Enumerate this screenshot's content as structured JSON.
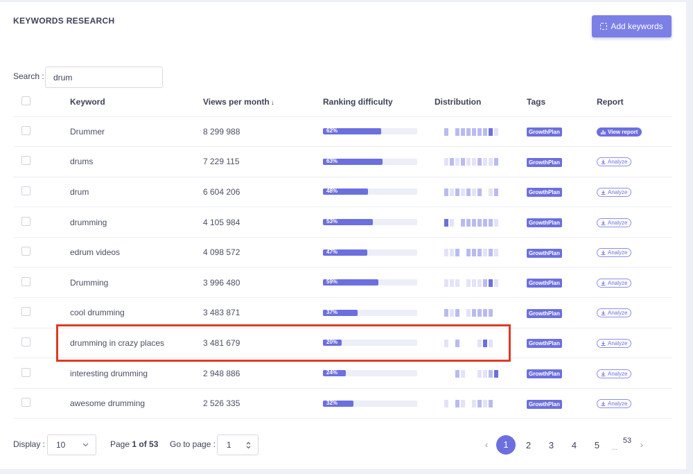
{
  "header": {
    "title": "KEYWORDS RESEARCH",
    "add_button": "Add keywords"
  },
  "search": {
    "label": "Search :",
    "value": "drum"
  },
  "table": {
    "columns": [
      "Keyword",
      "Views per month",
      "Ranking difficulty",
      "Distribution",
      "Tags",
      "Report"
    ],
    "sort_indicator": "↓",
    "rows": [
      {
        "keyword": "Drummer",
        "views": "8 299 988",
        "difficulty": 62,
        "difficulty_label": "62%",
        "tag": "GrowthPlan",
        "report": "View report",
        "report_type": "view",
        "dist": [
          2,
          0,
          2,
          2,
          2,
          2,
          2,
          2,
          3,
          1
        ]
      },
      {
        "keyword": "drums",
        "views": "7 229 115",
        "difficulty": 63,
        "difficulty_label": "63%",
        "tag": "GrowthPlan",
        "report": "Analyze",
        "report_type": "analyze",
        "dist": [
          1,
          2,
          1,
          2,
          1,
          1,
          2,
          1,
          1,
          2
        ]
      },
      {
        "keyword": "drum",
        "views": "6 604 206",
        "difficulty": 48,
        "difficulty_label": "48%",
        "tag": "GrowthPlan",
        "report": "Analyze",
        "report_type": "analyze",
        "dist": [
          2,
          1,
          2,
          1,
          2,
          1,
          2,
          0,
          1,
          2
        ]
      },
      {
        "keyword": "drumming",
        "views": "4 105 984",
        "difficulty": 53,
        "difficulty_label": "53%",
        "tag": "GrowthPlan",
        "report": "Analyze",
        "report_type": "analyze",
        "dist": [
          3,
          1,
          0,
          2,
          2,
          2,
          2,
          2,
          2,
          1
        ]
      },
      {
        "keyword": "edrum videos",
        "views": "4 098 572",
        "difficulty": 47,
        "difficulty_label": "47%",
        "tag": "GrowthPlan",
        "report": "Analyze",
        "report_type": "analyze",
        "dist": [
          1,
          1,
          2,
          0,
          2,
          2,
          2,
          1,
          2,
          1
        ]
      },
      {
        "keyword": "Drumming",
        "views": "3 996 480",
        "difficulty": 59,
        "difficulty_label": "59%",
        "tag": "GrowthPlan",
        "report": "Analyze",
        "report_type": "analyze",
        "dist": [
          1,
          1,
          1,
          0,
          1,
          1,
          1,
          2,
          3,
          1
        ]
      },
      {
        "keyword": "cool drumming",
        "views": "3 483 871",
        "difficulty": 37,
        "difficulty_label": "37%",
        "tag": "GrowthPlan",
        "report": "Analyze",
        "report_type": "analyze",
        "dist": [
          2,
          1,
          2,
          0,
          1,
          2,
          2,
          2,
          2,
          0
        ]
      },
      {
        "keyword": "drumming in crazy places",
        "views": "3 481 679",
        "difficulty": 20,
        "difficulty_label": "20%",
        "tag": "GrowthPlan",
        "report": "Analyze",
        "report_type": "analyze",
        "dist": [
          1,
          0,
          2,
          0,
          0,
          0,
          1,
          3,
          1,
          0
        ]
      },
      {
        "keyword": "interesting drumming",
        "views": "2 948 886",
        "difficulty": 24,
        "difficulty_label": "24%",
        "tag": "GrowthPlan",
        "report": "Analyze",
        "report_type": "analyze",
        "dist": [
          0,
          0,
          2,
          1,
          0,
          0,
          1,
          1,
          2,
          3
        ]
      },
      {
        "keyword": "awesome drumming",
        "views": "2 526 335",
        "difficulty": 32,
        "difficulty_label": "32%",
        "tag": "GrowthPlan",
        "report": "Analyze",
        "report_type": "analyze",
        "dist": [
          1,
          0,
          2,
          1,
          0,
          1,
          2,
          1,
          2,
          0
        ]
      }
    ]
  },
  "footer": {
    "display_label": "Display :",
    "display_value": "10",
    "page_prefix": "Page ",
    "page_current": "1 of 53",
    "goto_label": "Go to page :",
    "goto_value": "1",
    "pages": [
      "1",
      "2",
      "3",
      "4",
      "5"
    ],
    "dots": "...",
    "last_page": "53",
    "prev_icon": "‹",
    "next_icon": "›"
  },
  "colors": {
    "accent": "#6c6fde",
    "highlight": "#e03a22",
    "dist_levels": [
      "transparent",
      "#e2e3f8",
      "#b9bbf0",
      "#6c6fde"
    ]
  }
}
